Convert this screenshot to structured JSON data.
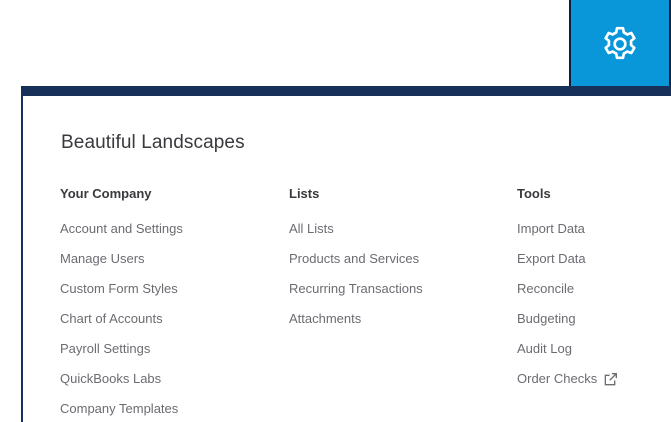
{
  "gear": {
    "icon": "gear-icon",
    "background": "#0a97d9"
  },
  "header": {
    "company_name": "Beautiful Landscapes"
  },
  "columns": [
    {
      "heading": "Your Company",
      "items": [
        {
          "label": "Account and Settings"
        },
        {
          "label": "Manage Users"
        },
        {
          "label": "Custom Form Styles"
        },
        {
          "label": "Chart of Accounts"
        },
        {
          "label": "Payroll Settings"
        },
        {
          "label": "QuickBooks Labs"
        },
        {
          "label": "Company Templates"
        }
      ]
    },
    {
      "heading": "Lists",
      "items": [
        {
          "label": "All Lists"
        },
        {
          "label": "Products and Services"
        },
        {
          "label": "Recurring Transactions"
        },
        {
          "label": "Attachments"
        }
      ]
    },
    {
      "heading": "Tools",
      "items": [
        {
          "label": "Import Data"
        },
        {
          "label": "Export Data"
        },
        {
          "label": "Reconcile"
        },
        {
          "label": "Budgeting"
        },
        {
          "label": "Audit Log"
        },
        {
          "label": "Order Checks",
          "icon": "external-link-icon"
        }
      ]
    }
  ],
  "colors": {
    "accent": "#0a97d9",
    "navy_bar": "#16305a",
    "heading_text": "#393a3d",
    "item_text": "#6b6c72"
  }
}
